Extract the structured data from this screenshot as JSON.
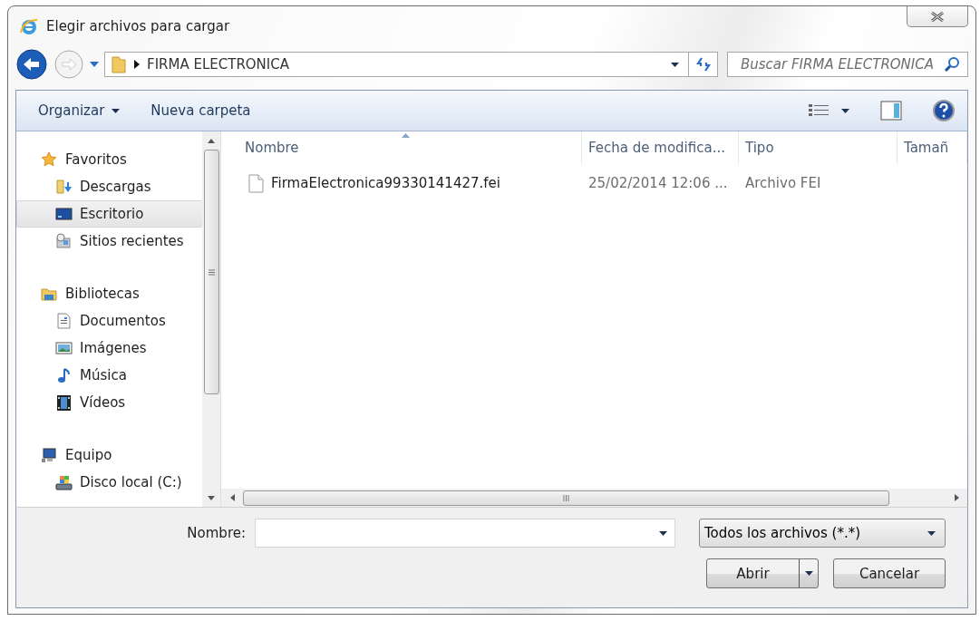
{
  "window": {
    "title": "Elegir archivos para cargar"
  },
  "address": {
    "path": "FIRMA ELECTRONICA"
  },
  "search": {
    "placeholder": "Buscar FIRMA ELECTRONICA"
  },
  "toolbar": {
    "buttons": [
      {
        "label": "Organizar",
        "dropdown": true
      },
      {
        "label": "Nueva carpeta",
        "dropdown": false
      }
    ]
  },
  "sidebar": {
    "groups": [
      {
        "label": "Favoritos",
        "selected": false,
        "children": [
          {
            "label": "Descargas",
            "selected": false
          },
          {
            "label": "Escritorio",
            "selected": true
          },
          {
            "label": "Sitios recientes",
            "selected": false
          }
        ]
      },
      {
        "label": "Bibliotecas",
        "selected": false,
        "children": [
          {
            "label": "Documentos",
            "selected": false
          },
          {
            "label": "Imágenes",
            "selected": false
          },
          {
            "label": "Música",
            "selected": false
          },
          {
            "label": "Vídeos",
            "selected": false
          }
        ]
      },
      {
        "label": "Equipo",
        "selected": false,
        "children": [
          {
            "label": "Disco local (C:)",
            "selected": false
          }
        ]
      }
    ]
  },
  "file_list": {
    "columns": [
      {
        "label": "Nombre",
        "sorted": true
      },
      {
        "label": "Fecha de modifica...",
        "sorted": false
      },
      {
        "label": "Tipo",
        "sorted": false
      },
      {
        "label": "Tamañ",
        "sorted": false
      }
    ],
    "rows": [
      {
        "cells": [
          "FirmaElectronica99330141427.fei",
          "25/02/2014 12:06 ...",
          "Archivo FEI"
        ]
      }
    ]
  },
  "file_name": {
    "label": "Nombre:"
  },
  "filter": {
    "value": "Todos los archivos (*.*)"
  },
  "buttons": [
    {
      "label": "Abrir",
      "split": true
    },
    {
      "label": "Cancelar",
      "split": false
    }
  ]
}
